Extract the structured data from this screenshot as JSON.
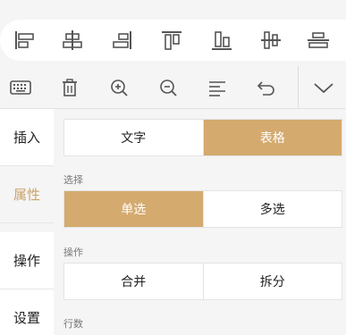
{
  "align_toolbar": {
    "icons": [
      "align-left-icon",
      "align-center-horizontal-icon",
      "align-right-icon",
      "align-top-icon",
      "align-bottom-icon",
      "align-center-vertical-icon",
      "distribute-icon"
    ]
  },
  "toolbar": {
    "icons": [
      "keyboard-icon",
      "trash-icon",
      "zoom-in-icon",
      "zoom-out-icon",
      "paragraph-align-icon",
      "undo-icon",
      "chevron-down-icon"
    ]
  },
  "sidebar": {
    "items": [
      {
        "label": "插入",
        "active": false
      },
      {
        "label": "属性",
        "active": true
      },
      {
        "label": "操作",
        "active": false
      },
      {
        "label": "设置",
        "active": false
      }
    ]
  },
  "panel": {
    "type_toggle": {
      "options": [
        "文字",
        "表格"
      ],
      "selected": "表格"
    },
    "select_label": "选择",
    "select_toggle": {
      "options": [
        "单选",
        "多选"
      ],
      "selected": "单选"
    },
    "operation_label": "操作",
    "operation_buttons": {
      "options": [
        "合并",
        "拆分"
      ]
    },
    "rows_label": "行数"
  },
  "colors": {
    "accent": "#d4aa6e",
    "active_text": "#c9a36a"
  }
}
